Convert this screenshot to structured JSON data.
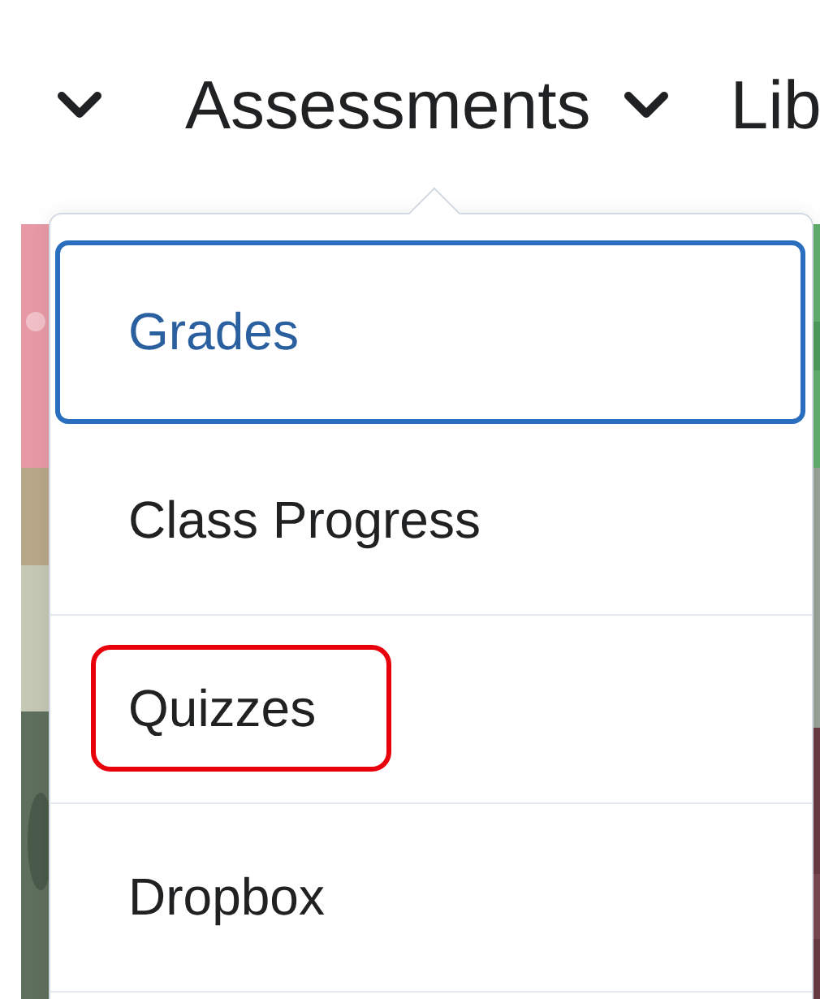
{
  "nav": [
    {
      "label": "Assessments",
      "expanded": true
    },
    {
      "label": "Lib",
      "expanded": false
    }
  ],
  "menu": [
    {
      "label": "Grades",
      "focused": true,
      "highlighted": false
    },
    {
      "label": "Class Progress",
      "focused": false,
      "highlighted": false
    },
    {
      "label": "Quizzes",
      "focused": false,
      "highlighted": true
    },
    {
      "label": "Dropbox",
      "focused": false,
      "highlighted": false
    }
  ]
}
